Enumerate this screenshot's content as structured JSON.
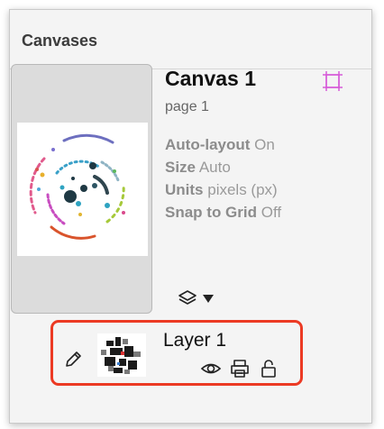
{
  "panel": {
    "title": "Canvases"
  },
  "canvas": {
    "name": "Canvas 1",
    "page": "page 1",
    "properties": [
      {
        "key": "Auto-layout",
        "value": "On"
      },
      {
        "key": "Size",
        "value": "Auto"
      },
      {
        "key": "Units",
        "value": "pixels (px)"
      },
      {
        "key": "Snap to Grid",
        "value": "Off"
      }
    ]
  },
  "layer": {
    "name": "Layer 1"
  },
  "icons": {
    "frame": "frame-icon",
    "layers": "layers-icon",
    "dropdown": "triangle-down-icon",
    "pencil": "pencil-icon",
    "visibility": "eye-icon",
    "print": "printer-icon",
    "lock": "unlock-icon"
  },
  "colors": {
    "highlight": "#ec3a24",
    "frame_icon": "#d65bd8"
  }
}
